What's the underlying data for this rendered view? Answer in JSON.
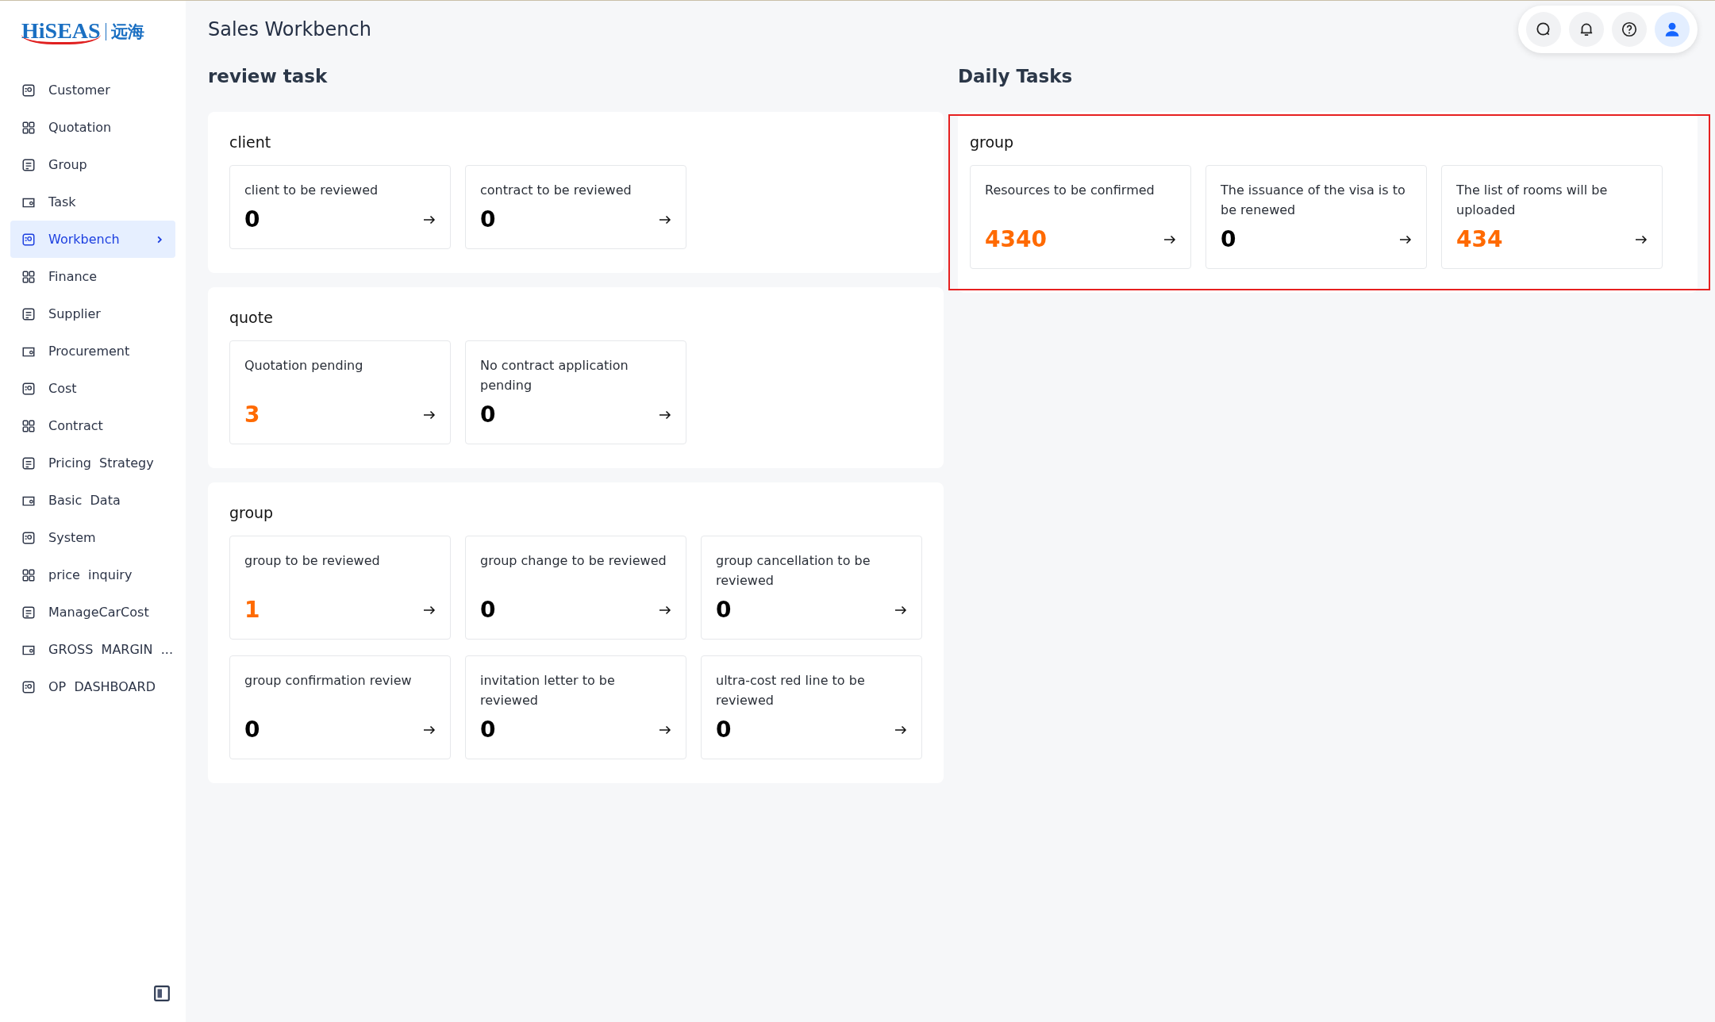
{
  "logo": {
    "brand": "HiSEAS",
    "chinese": "远海"
  },
  "sidebar": {
    "items": [
      {
        "label": "Customer",
        "selected": false
      },
      {
        "label": "Quotation",
        "selected": false
      },
      {
        "label": "Group",
        "selected": false
      },
      {
        "label": "Task",
        "selected": false
      },
      {
        "label": "Workbench",
        "selected": true
      },
      {
        "label": "Finance",
        "selected": false
      },
      {
        "label": "Supplier",
        "selected": false
      },
      {
        "label": "Procurement",
        "selected": false
      },
      {
        "label": "Cost",
        "selected": false
      },
      {
        "label": "Contract",
        "selected": false
      },
      {
        "label": "Pricing  Strategy",
        "selected": false
      },
      {
        "label": "Basic  Data",
        "selected": false
      },
      {
        "label": "System",
        "selected": false
      },
      {
        "label": "price  inquiry",
        "selected": false
      },
      {
        "label": "ManageCarCost",
        "selected": false
      },
      {
        "label": "GROSS  MARGIN  ...",
        "selected": false
      },
      {
        "label": "OP  DASHBOARD",
        "selected": false
      }
    ]
  },
  "header": {
    "title": "Sales Workbench"
  },
  "columns": [
    {
      "title": "review task",
      "panels": [
        {
          "title": "client",
          "highlighted": false,
          "cards": [
            {
              "label": "client to be reviewed",
              "count": "0",
              "alert": false
            },
            {
              "label": "contract to be reviewed",
              "count": "0",
              "alert": false
            }
          ]
        },
        {
          "title": "quote",
          "highlighted": false,
          "cards": [
            {
              "label": "Quotation pending",
              "count": "3",
              "alert": true
            },
            {
              "label": "No contract application pending",
              "count": "0",
              "alert": false
            }
          ]
        },
        {
          "title": "group",
          "highlighted": false,
          "cards": [
            {
              "label": "group to be reviewed",
              "count": "1",
              "alert": true
            },
            {
              "label": "group change to be reviewed",
              "count": "0",
              "alert": false
            },
            {
              "label": "group cancellation to be reviewed",
              "count": "0",
              "alert": false
            },
            {
              "label": "group confirmation review",
              "count": "0",
              "alert": false
            },
            {
              "label": "invitation letter to be reviewed",
              "count": "0",
              "alert": false
            },
            {
              "label": "ultra-cost red line to be reviewed",
              "count": "0",
              "alert": false
            }
          ]
        }
      ]
    },
    {
      "title": "Daily Tasks",
      "panels": [
        {
          "title": "group",
          "highlighted": true,
          "cards": [
            {
              "label": "Resources to be confirmed",
              "count": "4340",
              "alert": true
            },
            {
              "label": "The issuance of the visa is to be renewed",
              "count": "0",
              "alert": false
            },
            {
              "label": "The list of rooms will be uploaded",
              "count": "434",
              "alert": true
            }
          ]
        }
      ]
    }
  ]
}
